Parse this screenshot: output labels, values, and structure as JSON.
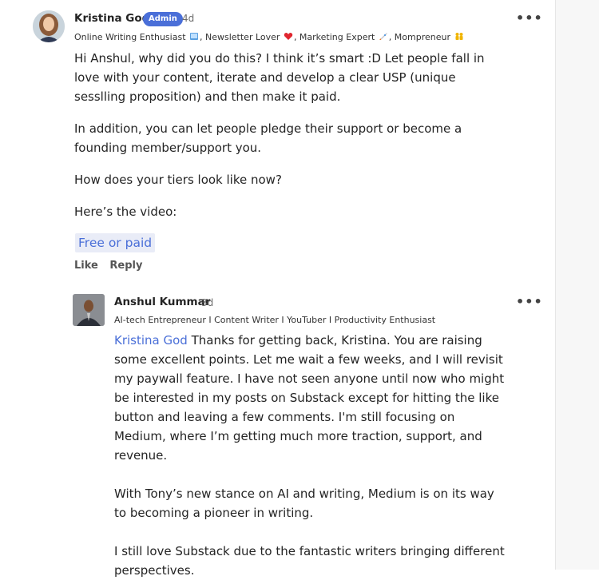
{
  "comments": [
    {
      "author": "Kristina God",
      "badge": "Admin",
      "age": "4d",
      "tagline_parts": [
        "Online Writing Enthusiast",
        ", Newsletter Lover",
        ", Marketing Expert",
        ", Mompreneur"
      ],
      "paragraphs": [
        "Hi Anshul, why did you do this? I think it’s smart :D Let people fall in love with your content, iterate and develop a clear USP (unique sesslling proposition) and then make it paid.",
        "In addition, you can let people pledge their support or become a founding member/support you.",
        "How does your tiers look like now?",
        "Here’s the video:"
      ],
      "video_link": "Free or paid",
      "actions": {
        "like": "Like",
        "reply": "Reply"
      }
    },
    {
      "author": "Anshul Kummar",
      "age": "3d",
      "tagline": "AI-tech Entrepreneur I Content Writer I YouTuber I Productivity Enthusiast",
      "mention": "Kristina God",
      "paragraphs": [
        "Thanks for getting back, Kristina. You are raising some excellent points. Let me wait a few weeks, and I will revisit my paywall feature. I have not seen anyone until now who might be interested in my posts on Substack except for hitting the like button and leaving a few comments. I'm still focusing on Medium, where I’m getting much more traction, support, and revenue.",
        "With Tony’s new stance on AI and writing, Medium is on its way to becoming a pioneer in writing.",
        "I still love Substack due to the fantastic writers bringing different perspectives."
      ]
    }
  ],
  "more_label": "•••",
  "icons": [
    "more-options-icon",
    "book-emoji-icon",
    "heart-emoji-icon",
    "rocket-emoji-icon",
    "family-emoji-icon"
  ],
  "colors": {
    "accent": "#4a6fd8",
    "chip_bg": "#e9ecf7",
    "text": "#242424",
    "muted": "#6b6b6b"
  }
}
